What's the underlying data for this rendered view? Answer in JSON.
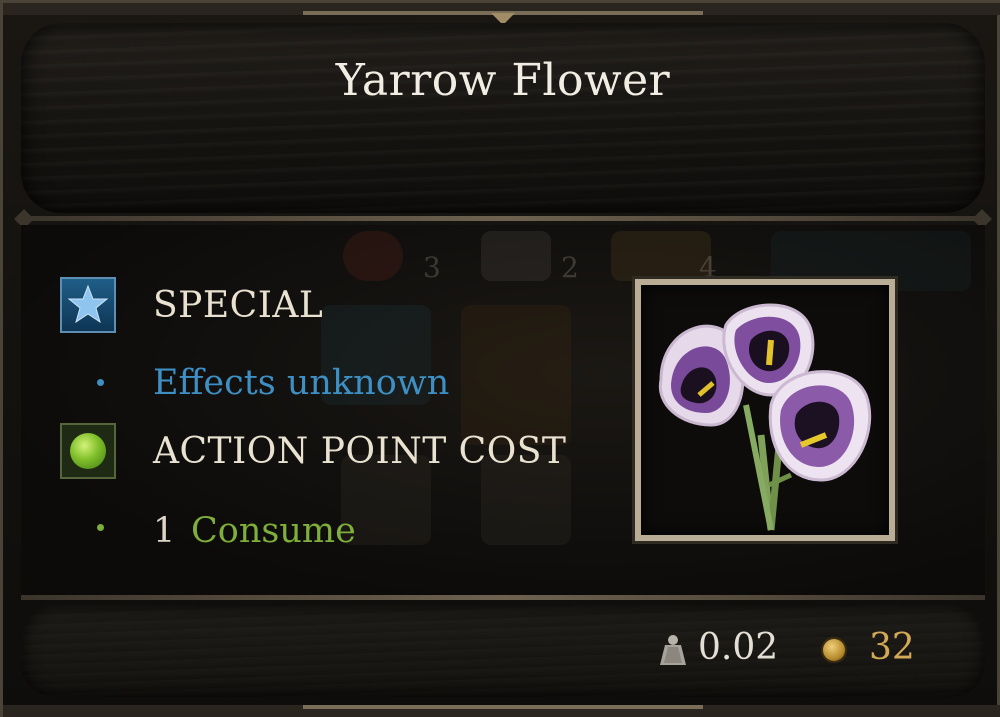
{
  "tooltip": {
    "title": "Yarrow Flower",
    "sections": {
      "special": {
        "heading": "SPECIAL",
        "icon": "star-icon",
        "effect": "Effects unknown",
        "bullet": "•"
      },
      "action_point_cost": {
        "heading": "ACTION POINT COST",
        "icon": "ap-dot-icon",
        "amount": "1",
        "action": "Consume",
        "bullet": "•"
      }
    },
    "item_icon": "yarrow-flower-icon",
    "footer": {
      "weight": "0.02",
      "weight_icon": "weight-icon",
      "value": "32",
      "value_icon": "gold-coin-icon"
    },
    "background_numbers": [
      "3",
      "2",
      "4"
    ]
  },
  "colors": {
    "title_text": "#f1ede3",
    "special_accent": "#3e8fc3",
    "ap_accent": "#7fae3a",
    "gold_text": "#d3a955",
    "frame": "#5b5245",
    "flower_purple": "#7a4a9a"
  }
}
